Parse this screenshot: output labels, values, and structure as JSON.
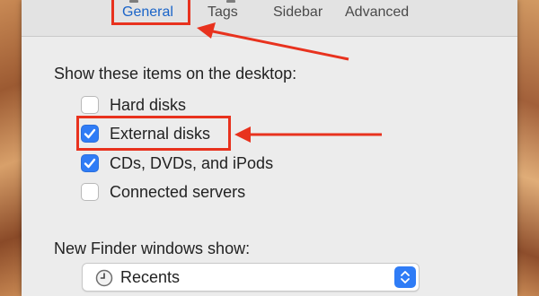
{
  "toolbar": {
    "tabs": [
      {
        "label": "General",
        "active": true
      },
      {
        "label": "Tags",
        "active": false
      },
      {
        "label": "Sidebar",
        "active": false
      },
      {
        "label": "Advanced",
        "active": false
      }
    ]
  },
  "desktop_section": {
    "heading": "Show these items on the desktop:",
    "items": [
      {
        "label": "Hard disks",
        "checked": false
      },
      {
        "label": "External disks",
        "checked": true
      },
      {
        "label": "CDs, DVDs, and iPods",
        "checked": true
      },
      {
        "label": "Connected servers",
        "checked": false
      }
    ]
  },
  "new_finder": {
    "heading": "New Finder windows show:",
    "selected": "Recents"
  },
  "colors": {
    "accent": "#2f7cf6",
    "annotation": "#e8321e",
    "active_tab": "#1a64c8"
  }
}
